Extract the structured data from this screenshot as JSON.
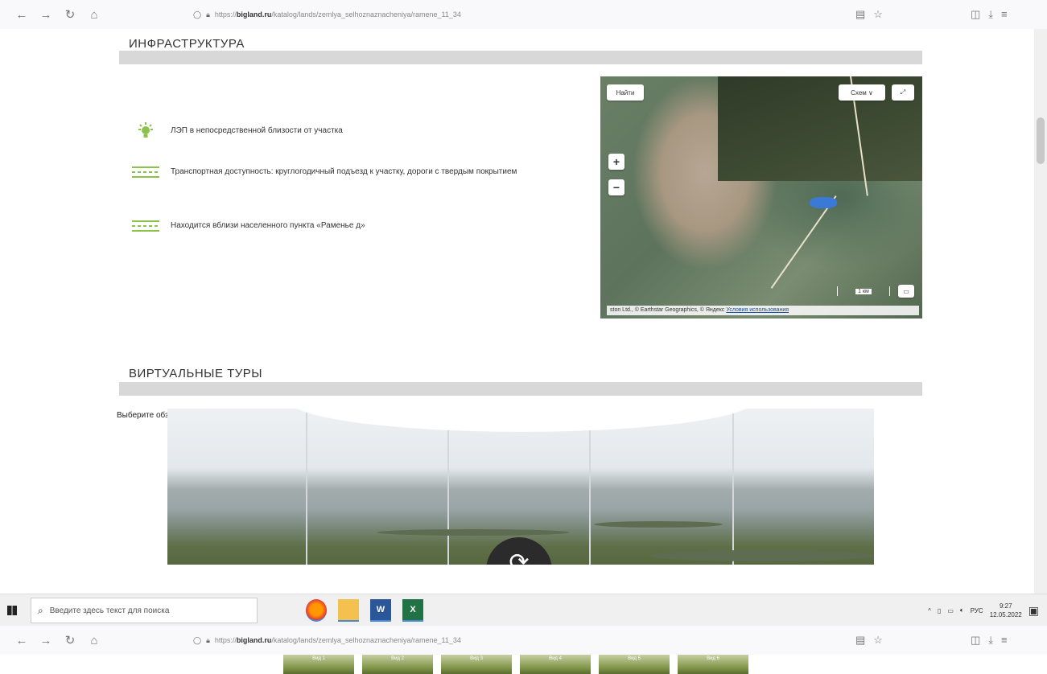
{
  "browser": {
    "url_prefix": "https://",
    "url_host": "bigland.ru",
    "url_path": "/katalog/lands/zemlya_selhoznaznacheniya/ramene_11_34"
  },
  "infra": {
    "title": "ИНФРАСТРУКТУРА",
    "items": [
      "ЛЭП в непосредственной близости от участка",
      "Транспортная доступность: круглогодичный подъезд к участку, дороги с твердым покрытием",
      "Находится вблизи населенного пункта «Раменье д»"
    ]
  },
  "map": {
    "find_button": "Найти",
    "layers_button": "Схем ∨",
    "expand_icon": "expand-icon",
    "zoom_in": "+",
    "zoom_out": "−",
    "scale_label": "1 км",
    "credit_text": "ston Ltd., © Earthstar Geographics, © Яндекс",
    "credit_link": "Условия использования"
  },
  "tours": {
    "title": "ВИРТУАЛЬНЫЕ ТУРЫ",
    "instruction": "Выберите обзорную точку, чтобы посмотреть виртуальный тур"
  },
  "taskbar": {
    "search_placeholder": "Введите здесь текст для поиска",
    "lang": "РУС",
    "time": "9:27",
    "date": "12.05.2022",
    "apps": [
      "firefox-icon",
      "file-explorer-icon",
      "word-icon",
      "excel-icon"
    ],
    "word_letter": "W",
    "excel_letter": "X"
  },
  "thumbnails": [
    "Вид 1",
    "Вид 2",
    "Вид 3",
    "Вид 4",
    "Вид 5",
    "Вид 6"
  ],
  "colors": {
    "accent_green": "#8bc34a",
    "section_bar": "#d8d8d8",
    "lake_blue": "#3b79d6"
  }
}
